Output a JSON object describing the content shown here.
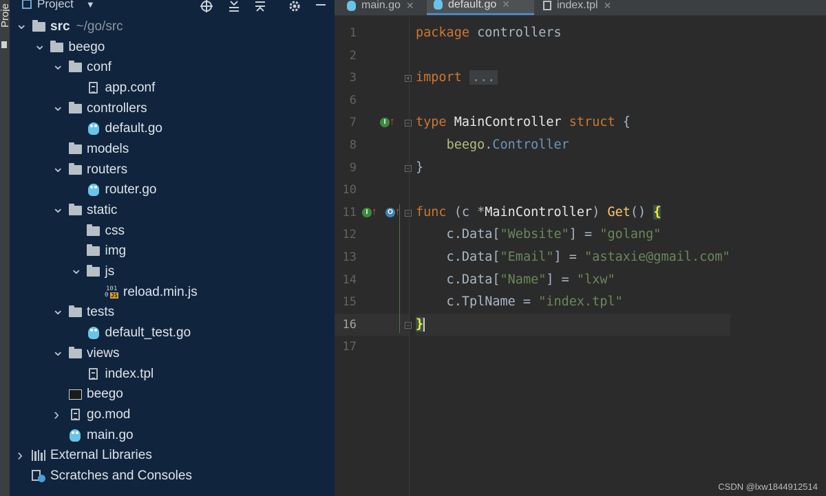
{
  "tool_strip": {
    "label": "Proje"
  },
  "project_panel": {
    "title": "Project",
    "tree": [
      {
        "indent": 0,
        "chevron": "down",
        "icon": "folder-icon",
        "label": "src",
        "suffix": "~/go/src",
        "bold": true
      },
      {
        "indent": 1,
        "chevron": "down",
        "icon": "folder-icon",
        "label": "beego"
      },
      {
        "indent": 2,
        "chevron": "down",
        "icon": "folder-icon",
        "label": "conf"
      },
      {
        "indent": 3,
        "chevron": "",
        "icon": "config-file-icon",
        "label": "app.conf"
      },
      {
        "indent": 2,
        "chevron": "down",
        "icon": "folder-icon",
        "label": "controllers"
      },
      {
        "indent": 3,
        "chevron": "",
        "icon": "go-file-icon",
        "label": "default.go"
      },
      {
        "indent": 2,
        "chevron": "",
        "icon": "folder-icon",
        "label": "models"
      },
      {
        "indent": 2,
        "chevron": "down",
        "icon": "folder-icon",
        "label": "routers"
      },
      {
        "indent": 3,
        "chevron": "",
        "icon": "go-file-icon",
        "label": "router.go"
      },
      {
        "indent": 2,
        "chevron": "down",
        "icon": "folder-icon",
        "label": "static"
      },
      {
        "indent": 3,
        "chevron": "",
        "icon": "folder-icon",
        "label": "css"
      },
      {
        "indent": 3,
        "chevron": "",
        "icon": "folder-icon",
        "label": "img"
      },
      {
        "indent": 3,
        "chevron": "down",
        "icon": "folder-icon",
        "label": "js"
      },
      {
        "indent": 4,
        "chevron": "",
        "icon": "js-file-icon",
        "label": "reload.min.js"
      },
      {
        "indent": 2,
        "chevron": "down",
        "icon": "folder-icon",
        "label": "tests"
      },
      {
        "indent": 3,
        "chevron": "",
        "icon": "go-test-file-icon",
        "label": "default_test.go"
      },
      {
        "indent": 2,
        "chevron": "down",
        "icon": "folder-icon",
        "label": "views"
      },
      {
        "indent": 3,
        "chevron": "",
        "icon": "template-file-icon",
        "label": "index.tpl"
      },
      {
        "indent": 2,
        "chevron": "",
        "icon": "executable-icon",
        "label": "beego"
      },
      {
        "indent": 2,
        "chevron": "right",
        "icon": "config-file-icon",
        "label": "go.mod"
      },
      {
        "indent": 2,
        "chevron": "",
        "icon": "go-file-icon",
        "label": "main.go"
      },
      {
        "indent": 0,
        "chevron": "right",
        "icon": "libraries-icon",
        "label": "External Libraries"
      },
      {
        "indent": 0,
        "chevron": "",
        "icon": "scratches-icon",
        "label": "Scratches and Consoles"
      }
    ]
  },
  "tabs": [
    {
      "label": "main.go",
      "icon": "go-file-icon",
      "active": false
    },
    {
      "label": "default.go",
      "icon": "go-file-icon",
      "active": true
    },
    {
      "label": "index.tpl",
      "icon": "template-file-icon",
      "active": false
    }
  ],
  "editor": {
    "current_line": "16",
    "lines": [
      {
        "num": "1",
        "tokens": [
          [
            "kw",
            "package "
          ],
          [
            "plain",
            "controllers"
          ]
        ]
      },
      {
        "num": "2",
        "tokens": []
      },
      {
        "num": "3",
        "tokens": [
          [
            "kw",
            "import "
          ],
          [
            "ellipsis",
            "..."
          ]
        ],
        "fold": "+"
      },
      {
        "num": "6",
        "tokens": []
      },
      {
        "num": "7",
        "tokens": [
          [
            "kw",
            "type "
          ],
          [
            "typ",
            "MainController "
          ],
          [
            "kw",
            "struct "
          ],
          [
            "plain",
            "{"
          ]
        ],
        "fold": "-",
        "badges": [
          "implemented"
        ]
      },
      {
        "num": "8",
        "tokens": [
          [
            "plain",
            "    "
          ],
          [
            "ident",
            "beego"
          ],
          [
            "plain",
            "."
          ],
          [
            "ctrl",
            "Controller"
          ]
        ]
      },
      {
        "num": "9",
        "tokens": [
          [
            "plain",
            "}"
          ]
        ],
        "fold": "-"
      },
      {
        "num": "10",
        "tokens": []
      },
      {
        "num": "11",
        "tokens": [
          [
            "kw",
            "func "
          ],
          [
            "plain",
            "(c *"
          ],
          [
            "typ",
            "MainController"
          ],
          [
            "plain",
            ") "
          ],
          [
            "fnc",
            "Get"
          ],
          [
            "plain",
            "() "
          ],
          [
            "brace",
            "{"
          ]
        ],
        "fold": "-",
        "badges": [
          "implemented",
          "overrides"
        ]
      },
      {
        "num": "12",
        "tokens": [
          [
            "plain",
            "    c.Data["
          ],
          [
            "str",
            "\"Website\""
          ],
          [
            "plain",
            "] = "
          ],
          [
            "str",
            "\"golang\""
          ]
        ]
      },
      {
        "num": "13",
        "tokens": [
          [
            "plain",
            "    c.Data["
          ],
          [
            "str",
            "\"Email\""
          ],
          [
            "plain",
            "] = "
          ],
          [
            "str",
            "\"astaxie@gmail.com\""
          ]
        ]
      },
      {
        "num": "14",
        "tokens": [
          [
            "plain",
            "    c.Data["
          ],
          [
            "str",
            "\"Name\""
          ],
          [
            "plain",
            "] = "
          ],
          [
            "str",
            "\"lxw\""
          ]
        ]
      },
      {
        "num": "15",
        "tokens": [
          [
            "plain",
            "    c.TplName = "
          ],
          [
            "str",
            "\"index.tpl\""
          ]
        ]
      },
      {
        "num": "16",
        "tokens": [
          [
            "brace",
            "}"
          ]
        ],
        "fold": "-"
      },
      {
        "num": "17",
        "tokens": []
      }
    ]
  },
  "watermark": "CSDN @lxw1844912514"
}
